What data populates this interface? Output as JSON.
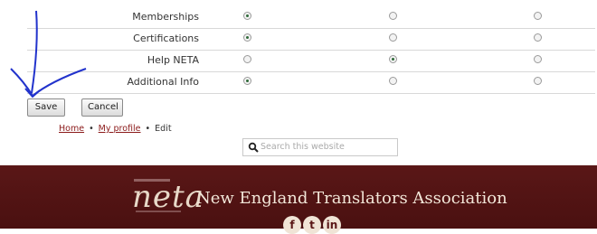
{
  "privacy_rows": [
    {
      "label": "Memberships",
      "selected": 1
    },
    {
      "label": "Certifications",
      "selected": 1
    },
    {
      "label": "Help NETA",
      "selected": 2
    },
    {
      "label": "Additional Info",
      "selected": 1
    }
  ],
  "buttons": {
    "save": "Save",
    "cancel": "Cancel"
  },
  "breadcrumb": {
    "home": "Home",
    "profile": "My profile",
    "current": "Edit",
    "separator": "•"
  },
  "search": {
    "placeholder": "Search this website",
    "icon": "search-icon"
  },
  "footer": {
    "logo_text": "neta",
    "org_name": "New England Translators Association",
    "social_icons": [
      "facebook-icon",
      "twitter-icon",
      "linkedin-icon"
    ],
    "bg_color": "#541414"
  },
  "annotation": {
    "type": "hand-drawn-arrow",
    "color": "#2233cc"
  }
}
